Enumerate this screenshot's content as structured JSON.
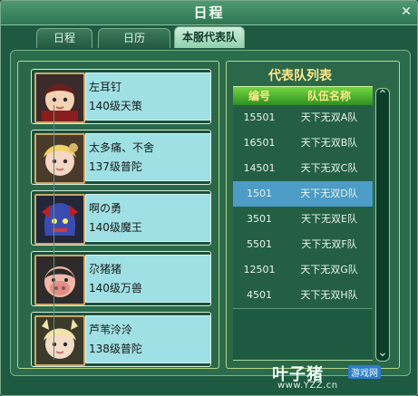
{
  "window": {
    "title": "日程",
    "close_glyph": "✕"
  },
  "tabs": [
    {
      "label": "日程",
      "active": false
    },
    {
      "label": "日历",
      "active": false
    },
    {
      "label": "本服代表队",
      "active": true
    }
  ],
  "players": [
    {
      "name": "左耳钉",
      "level": "140级天策"
    },
    {
      "name": "太多痛、不舍",
      "level": "137级普陀"
    },
    {
      "name": "啊の勇",
      "level": "140级魔王"
    },
    {
      "name": "尕猪猪",
      "level": "140级万兽"
    },
    {
      "name": "芦苇泠泠",
      "level": "138级普陀"
    }
  ],
  "teamTable": {
    "title": "代表队列表",
    "headers": [
      "编号",
      "队伍名称"
    ],
    "rows": [
      {
        "id": "15501",
        "team": "天下无双A队",
        "selected": false
      },
      {
        "id": "16501",
        "team": "天下无双B队",
        "selected": false
      },
      {
        "id": "14501",
        "team": "天下无双C队",
        "selected": false
      },
      {
        "id": "1501",
        "team": "天下无双D队",
        "selected": true
      },
      {
        "id": "3501",
        "team": "天下无双E队",
        "selected": false
      },
      {
        "id": "5501",
        "team": "天下无双F队",
        "selected": false
      },
      {
        "id": "12501",
        "team": "天下无双G队",
        "selected": false
      },
      {
        "id": "4501",
        "team": "天下无双H队",
        "selected": false
      }
    ],
    "scroll_up_glyph": "⌃",
    "scroll_down_glyph": "⌄"
  },
  "watermark": {
    "brand": "叶子猪",
    "sub": "游戏网",
    "url": "www.YZZ.cn"
  },
  "colors": {
    "selected_row": "#4c9cc7",
    "header_text": "#ffe98a",
    "accent_green": "#2f8f23"
  }
}
